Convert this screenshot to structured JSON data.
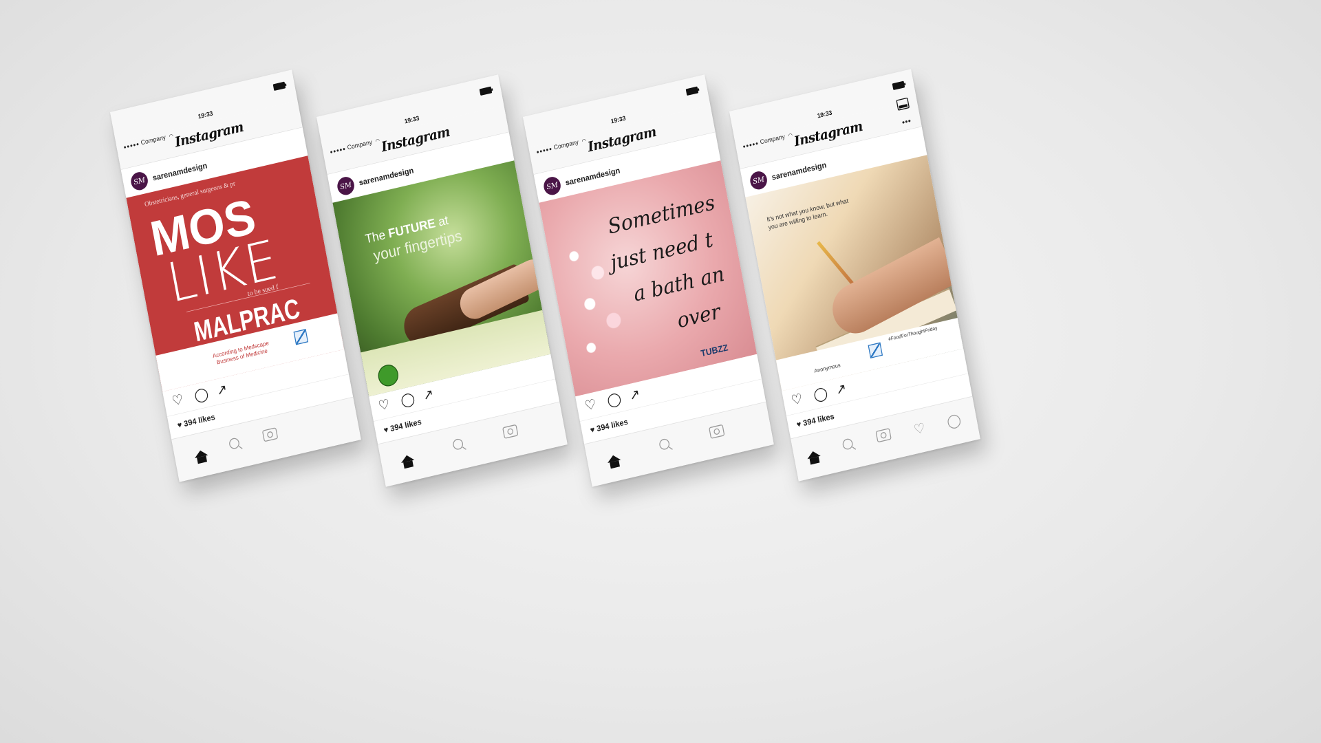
{
  "status": {
    "carrier": "Company",
    "time": "19:33"
  },
  "app": {
    "title": "Instagram"
  },
  "post_header": {
    "username": "sarenamdesign",
    "avatar_initials": "SM"
  },
  "likes": {
    "text": "394 likes"
  },
  "tabs": {
    "home": "home-icon",
    "search": "search-icon",
    "camera": "camera-icon",
    "activity": "heart-icon",
    "profile": "profile-icon"
  },
  "phones": [
    {
      "post": {
        "top_text": "Obstetricians, general surgeons & pr",
        "big_1": "MOS",
        "big_2": "LIKE",
        "small": "to be sued f",
        "big_3": "MALPRAC",
        "source": "According to Medscape Business of Medicine"
      }
    },
    {
      "post": {
        "line_1a": "The ",
        "line_1b": "FUTURE",
        "line_1c": " at",
        "line_2": "your fingertips"
      }
    },
    {
      "post": {
        "line_1": "Sometimes",
        "line_2": "just need t",
        "line_3": "a bath an",
        "line_4": "over",
        "brand": "TUBZZ"
      }
    },
    {
      "post": {
        "quote": "It's not what you know, but what you are willing to learn.",
        "attribution": "Anonymous",
        "hashtag": "#FoodForThoughtFriday"
      }
    }
  ],
  "colors": {
    "red_post": "#c13b3b",
    "avatar": "#4a1547",
    "pink_post": "#eaa9ad"
  }
}
